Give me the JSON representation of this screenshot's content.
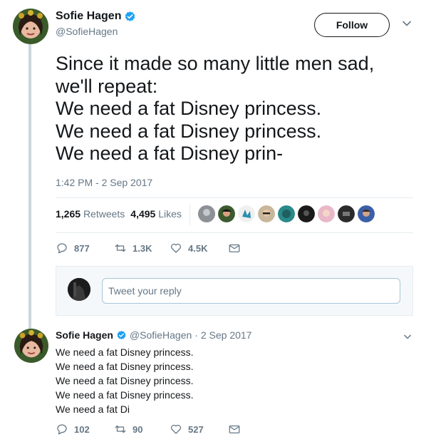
{
  "main_tweet": {
    "author": {
      "name": "Sofie Hagen",
      "handle": "@SofieHagen"
    },
    "follow_label": "Follow",
    "text_lines": [
      "Since it made so many little men sad,",
      "we'll repeat:",
      "We need a fat Disney princess.",
      "We need a fat Disney princess.",
      "We need a fat Disney prin-"
    ],
    "timestamp": "1:42 PM - 2 Sep 2017",
    "stats": {
      "retweets_count": "1,265",
      "retweets_label": "Retweets",
      "likes_count": "4,495",
      "likes_label": "Likes"
    },
    "actions": {
      "replies": "877",
      "retweets": "1.3K",
      "likes": "4.5K"
    }
  },
  "reply_box": {
    "placeholder": "Tweet your reply"
  },
  "reply_tweet": {
    "author": {
      "name": "Sofie Hagen",
      "handle": "@SofieHagen"
    },
    "date": "· 2 Sep 2017",
    "text_lines": [
      "We need a fat Disney princess.",
      "We need a fat Disney princess.",
      "We need a fat Disney princess.",
      "We need a fat Disney princess.",
      "We need a fat Di"
    ],
    "actions": {
      "replies": "102",
      "retweets": "90",
      "likes": "527"
    }
  },
  "colors": {
    "verified": "#1da1f2",
    "muted": "#657786",
    "text": "#14171a",
    "divider": "#e6ecf0"
  }
}
